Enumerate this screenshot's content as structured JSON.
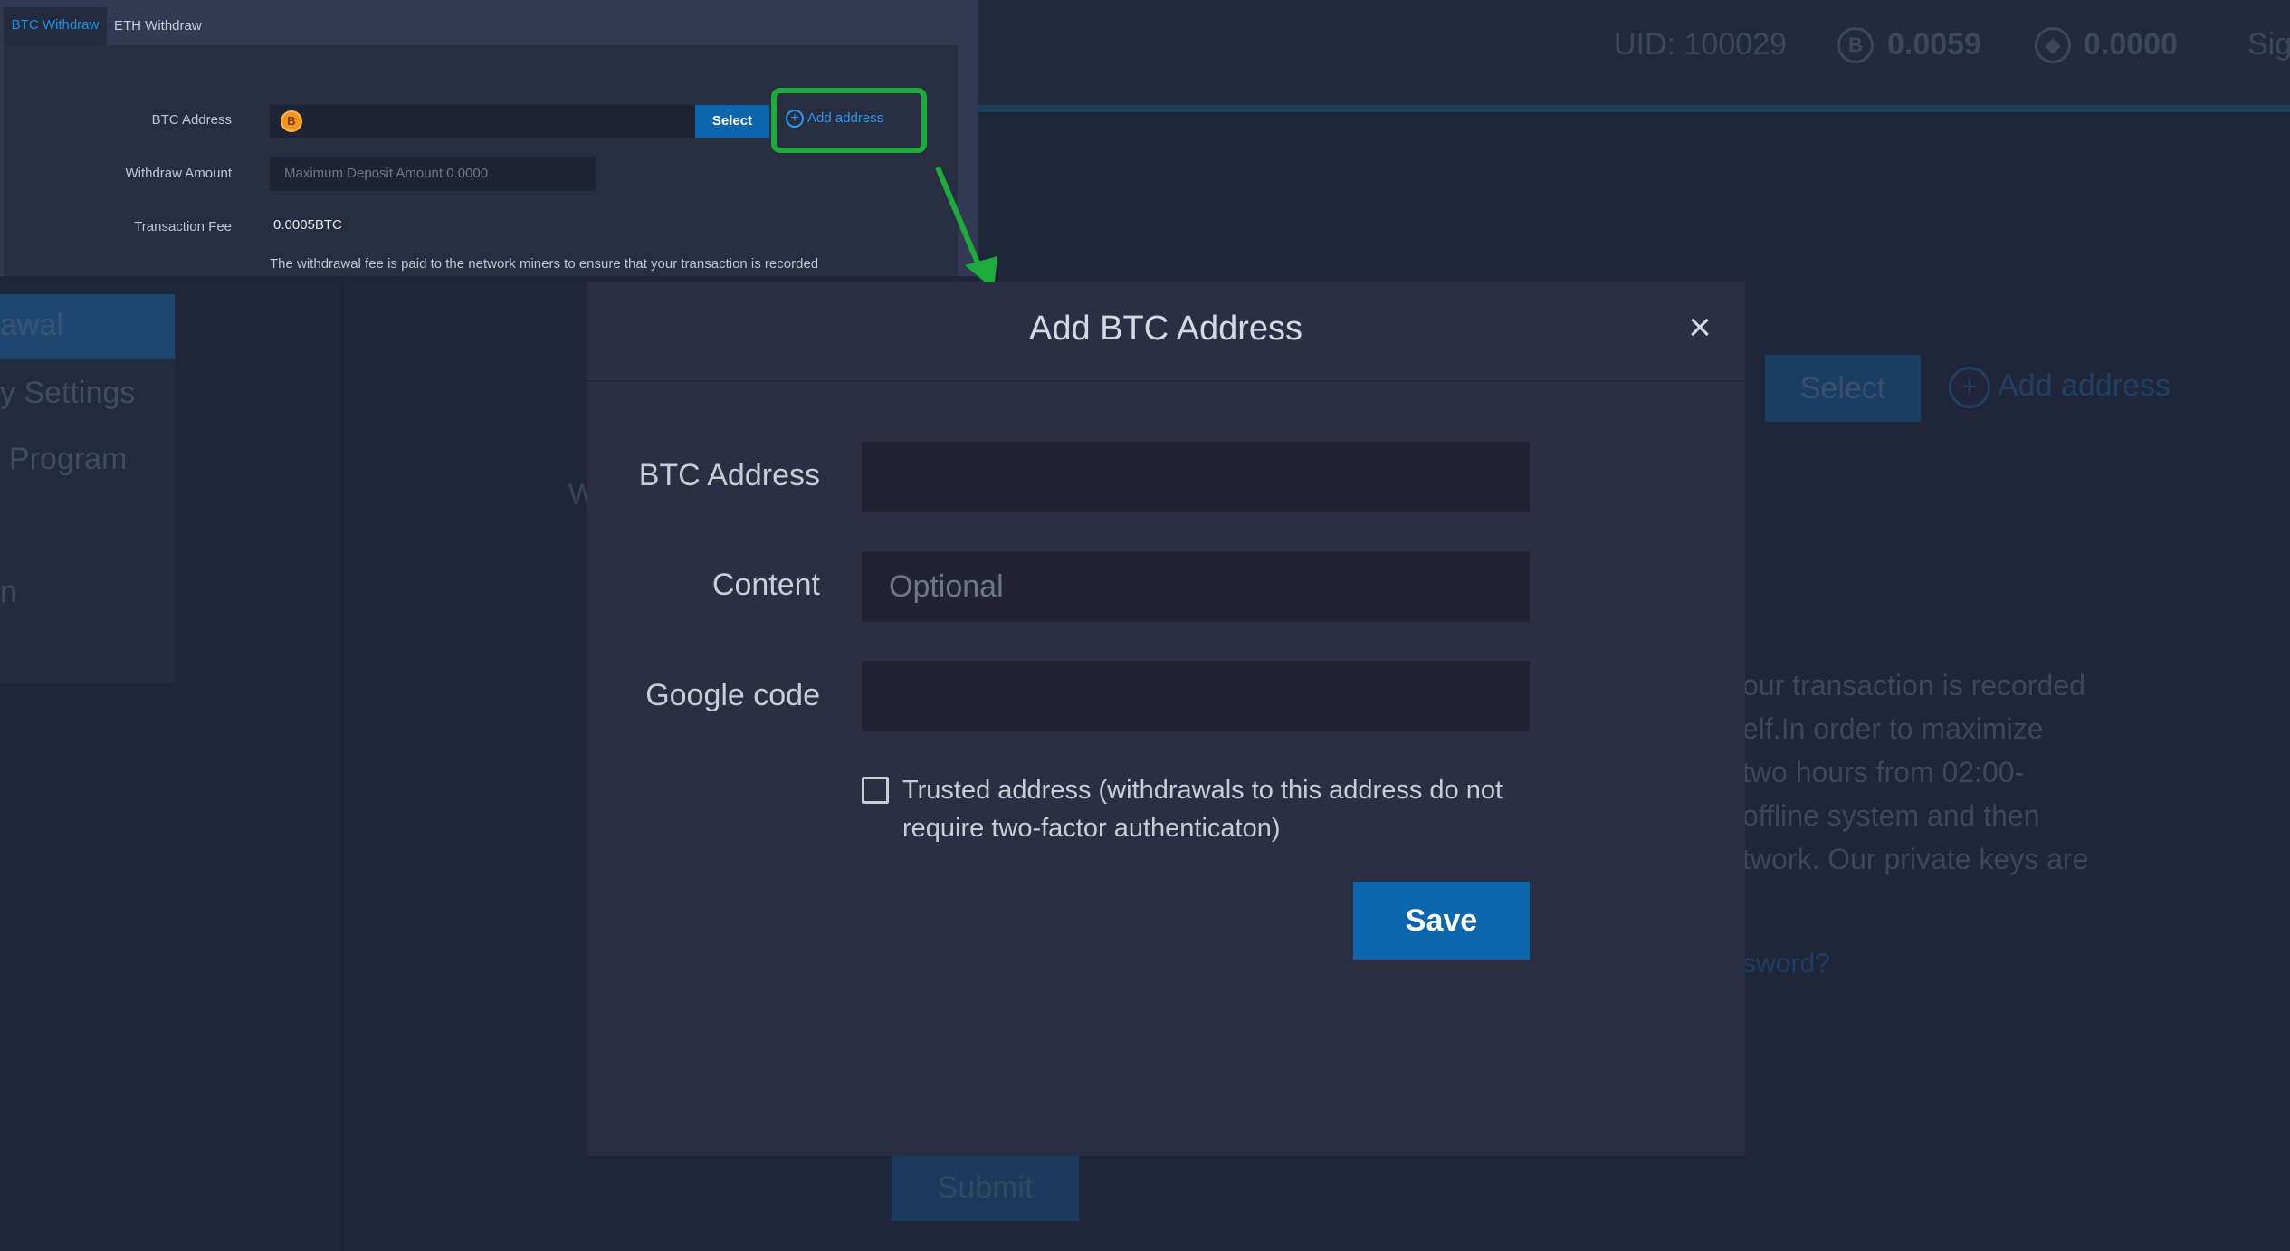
{
  "background": {
    "uid_label": "UID: 100029",
    "btc_balance": "0.0059",
    "eth_balance": "0.0000",
    "sign_fragment": "Sig",
    "sidebar_items": [
      "awal",
      "y Settings",
      "Program",
      "n"
    ],
    "select_label": "Select",
    "add_address_label": "Add address",
    "fee_paragraph_lines": [
      "our transaction is recorded",
      "elf.In order to maximize",
      "two hours from 02:00-",
      "offline system and then",
      "twork. Our private keys are"
    ],
    "forgot_fragment": "sword?",
    "w_fragment": "W",
    "submit_label": "Submit"
  },
  "inset": {
    "tabs": [
      {
        "label": "BTC Withdraw",
        "active": true
      },
      {
        "label": "ETH Withdraw",
        "active": false
      }
    ],
    "btc_address_label": "BTC Address",
    "btc_icon": "B",
    "select_label": "Select",
    "add_address_label": "Add address",
    "withdraw_amount_label": "Withdraw Amount",
    "withdraw_amount_placeholder": "Maximum Deposit Amount 0.0000",
    "transaction_fee_label": "Transaction Fee",
    "transaction_fee_value": "0.0005BTC",
    "fee_note": "The withdrawal fee is paid to the network miners to ensure that your transaction is recorded",
    "highlight_color": "#1eaa3c"
  },
  "modal": {
    "title": "Add BTC Address",
    "close_icon": "×",
    "fields": {
      "btc_address_label": "BTC Address",
      "btc_address_value": "",
      "content_label": "Content",
      "content_placeholder": "Optional",
      "google_code_label": "Google code",
      "google_code_value": ""
    },
    "trusted_checkbox_label": "Trusted address (withdrawals to this address do not require two-factor authenticaton)",
    "trusted_checked": false,
    "save_label": "Save",
    "accent_color": "#0d66ad"
  }
}
